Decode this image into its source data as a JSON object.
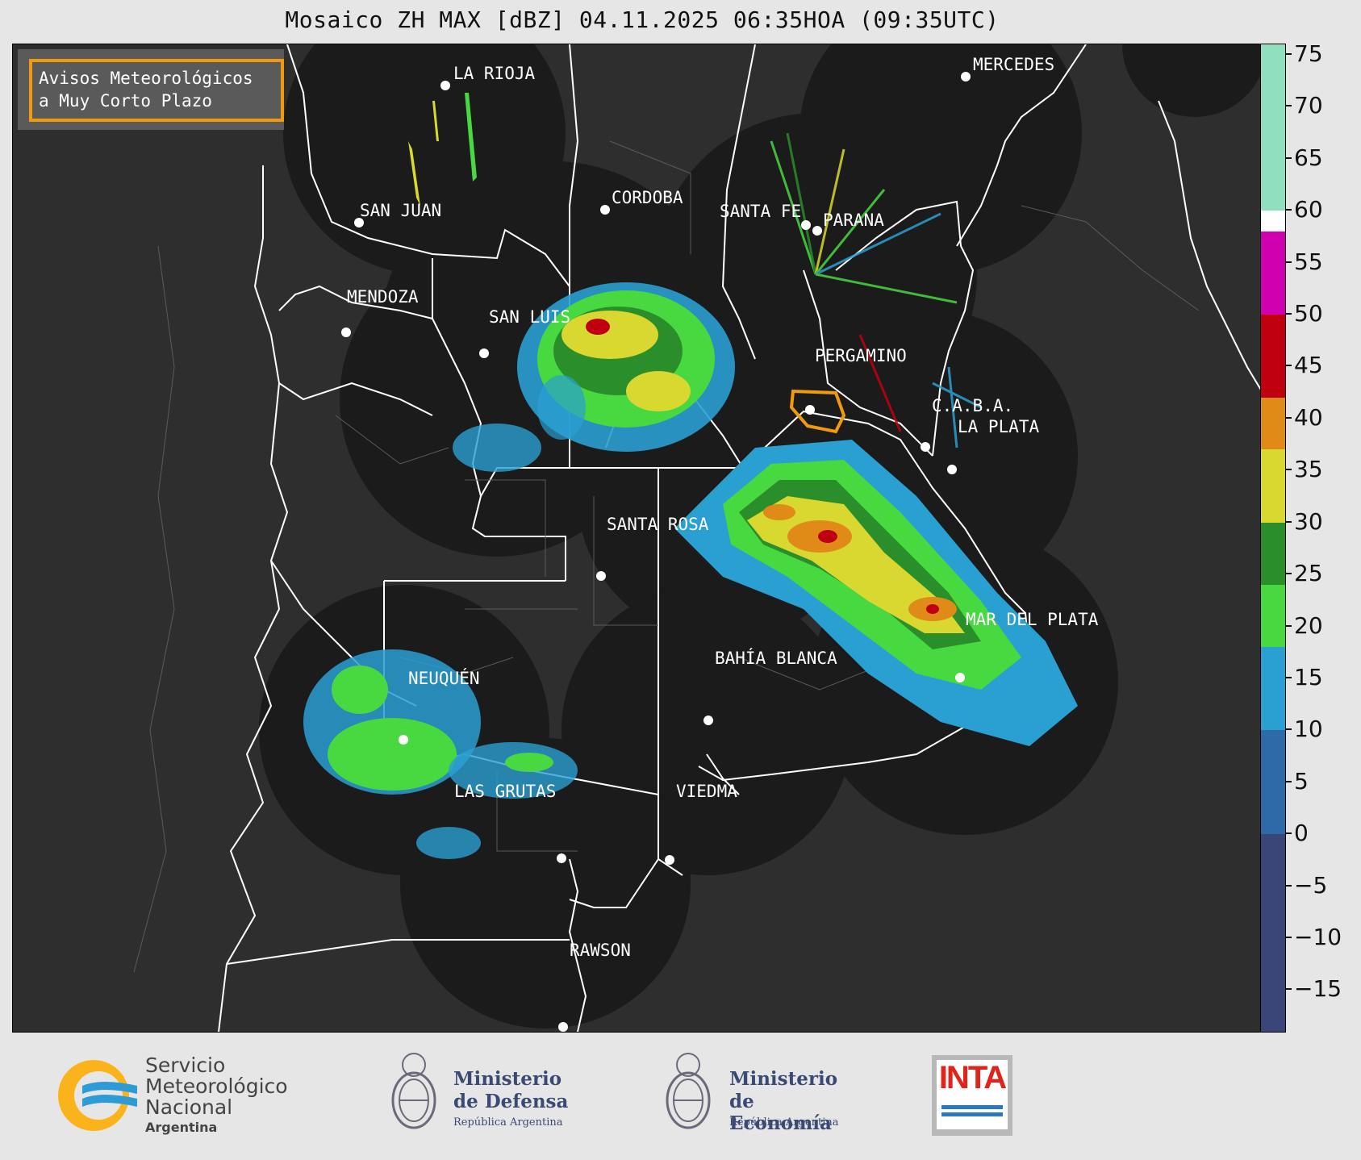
{
  "title": "Mosaico ZH MAX [dBZ] 04.11.2025 06:35HOA (09:35UTC)",
  "warning_box": {
    "line1": "Avisos Meteorológicos",
    "line2": "a Muy Corto Plazo",
    "border_color": "#f09a0c"
  },
  "cities": [
    {
      "name": "LA RIOJA"
    },
    {
      "name": "MERCEDES"
    },
    {
      "name": "SAN JUAN"
    },
    {
      "name": "CORDOBA"
    },
    {
      "name": "SANTA FE"
    },
    {
      "name": "PARANA"
    },
    {
      "name": "MENDOZA"
    },
    {
      "name": "SAN LUIS"
    },
    {
      "name": "PERGAMINO"
    },
    {
      "name": "C.A.B.A."
    },
    {
      "name": "LA PLATA"
    },
    {
      "name": "SANTA ROSA"
    },
    {
      "name": "MAR DEL PLATA"
    },
    {
      "name": "BAHÍA BLANCA"
    },
    {
      "name": "NEUQUÉN"
    },
    {
      "name": "LAS GRUTAS"
    },
    {
      "name": "VIEDMA"
    },
    {
      "name": "RAWSON"
    }
  ],
  "colorbar": {
    "unit": "dBZ",
    "min": -19,
    "max": 76,
    "tick_labels": [
      "75",
      "70",
      "65",
      "60",
      "55",
      "50",
      "45",
      "40",
      "35",
      "30",
      "25",
      "20",
      "15",
      "10",
      "5",
      "0",
      "−5",
      "−10",
      "−15"
    ],
    "tick_values": [
      75,
      70,
      65,
      60,
      55,
      50,
      45,
      40,
      35,
      30,
      25,
      20,
      15,
      10,
      5,
      0,
      -5,
      -10,
      -15
    ],
    "bands": [
      {
        "from": -19,
        "to": 0,
        "color": "#3a4678"
      },
      {
        "from": 0,
        "to": 10,
        "color": "#2f6aa8"
      },
      {
        "from": 10,
        "to": 18,
        "color": "#2a9fd2"
      },
      {
        "from": 18,
        "to": 24,
        "color": "#48d840"
      },
      {
        "from": 24,
        "to": 30,
        "color": "#2a8f2a"
      },
      {
        "from": 30,
        "to": 37,
        "color": "#d8d830"
      },
      {
        "from": 37,
        "to": 42,
        "color": "#e08a18"
      },
      {
        "from": 42,
        "to": 50,
        "color": "#c00010"
      },
      {
        "from": 50,
        "to": 58,
        "color": "#d000b0"
      },
      {
        "from": 58,
        "to": 60,
        "color": "#ffffff"
      },
      {
        "from": 60,
        "to": 76,
        "color": "#90e0c0"
      }
    ]
  },
  "footer": {
    "smn_line1": "Servicio",
    "smn_line2": "Meteorológico",
    "smn_line3": "Nacional",
    "smn_line4": "Argentina",
    "defensa_line1": "Ministerio",
    "defensa_line2": "de Defensa",
    "defensa_line3": "República Argentina",
    "economia_line1": "Ministerio",
    "economia_line2": "de Economía",
    "economia_line3": "República Argentina",
    "inta": "INTA"
  }
}
